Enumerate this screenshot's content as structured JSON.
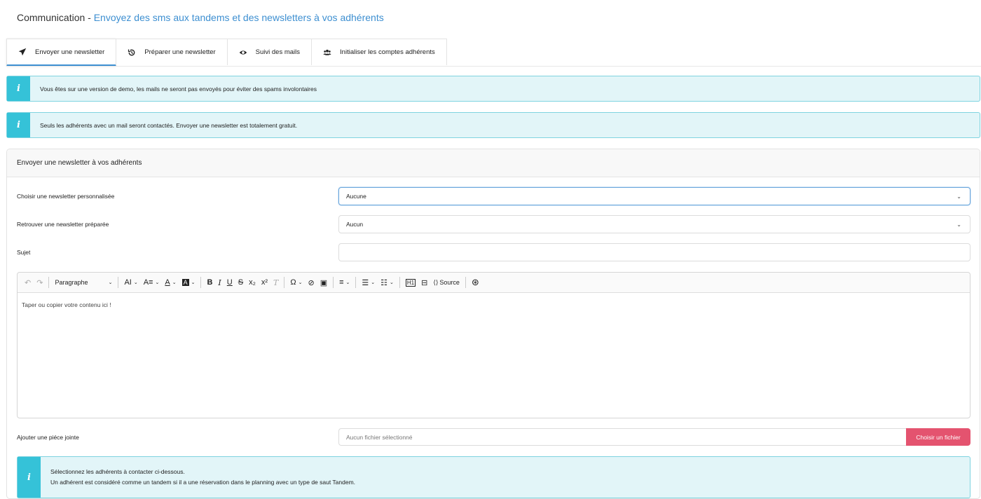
{
  "header": {
    "title": "Communication",
    "separator": " - ",
    "subtitle": "Envoyez des sms aux tandems et des newsletters à vos adhérents"
  },
  "tabs": [
    {
      "label": "Envoyer une newsletter",
      "icon": "paper-plane-icon",
      "active": true
    },
    {
      "label": "Préparer une newsletter",
      "icon": "history-icon",
      "active": false
    },
    {
      "label": "Suivi des mails",
      "icon": "eye-icon",
      "active": false
    },
    {
      "label": "Initialiser les comptes adhérents",
      "icon": "users-icon",
      "active": false
    }
  ],
  "alerts": {
    "demo": "Vous êtes sur une version de demo, les mails ne seront pas envoyés pour éviter des spams involontaires",
    "info": "Seuls les adhérents avec un mail seront contactés. Envoyer une newsletter est totalement gratuit.",
    "icon_glyph": "i"
  },
  "card": {
    "title": "Envoyer une newsletter à vos adhérents",
    "fields": {
      "custom_newsletter_label": "Choisir une newsletter personnalisée",
      "custom_newsletter_value": "Aucune",
      "prepared_newsletter_label": "Retrouver une newsletter préparée",
      "prepared_newsletter_value": "Aucun",
      "subject_label": "Sujet",
      "subject_value": ""
    },
    "editor": {
      "paragraph_label": "Paragraphe",
      "source_label": "Source",
      "placeholder": "Taper ou copier votre contenu ici !"
    },
    "attachment": {
      "label": "Ajouter une piéce jointe",
      "no_file": "Aucun fichier sélectionné",
      "button": "Choisir un fichier"
    },
    "selection_alert": {
      "line1": "Sélectionnez les adhérents à contacter ci-dessous.",
      "line2": "Un adhérent est considéré comme un tandem si il a une réservation dans le planning avec un type de saut Tandem."
    }
  },
  "colors": {
    "accent": "#3d8fd1",
    "info_bg": "#e2f5f8",
    "info_icon_bg": "#35c2d8",
    "button_pink": "#e4536f"
  }
}
